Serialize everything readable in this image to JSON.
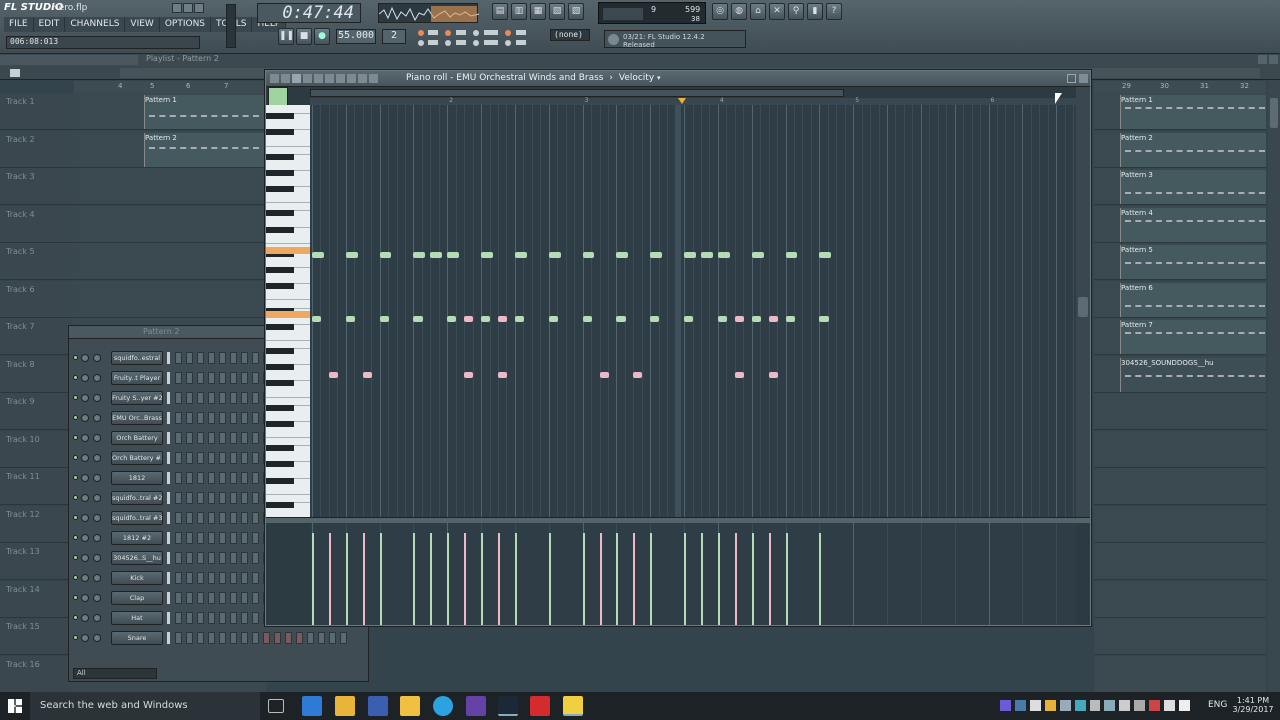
{
  "app": {
    "title": "Hero.flp",
    "logo": "FL STUDIO"
  },
  "menu": [
    "FILE",
    "EDIT",
    "CHANNELS",
    "VIEW",
    "OPTIONS",
    "TOOLS",
    "HELP"
  ],
  "position_readout": "006:08:013",
  "song_time": "0:47:44",
  "tempo": "55.000",
  "pattern_number": "2",
  "pattern_select": "(none)",
  "hint_bar": {
    "line1": "03/21: FL Studio 12.4.2",
    "line2": "Released"
  },
  "cpu": {
    "poly": "9",
    "mem": "599",
    "cpu_val": "38"
  },
  "playlist": {
    "title": "Playlist - Pattern 2",
    "ruler": [
      "4",
      "5",
      "6",
      "7"
    ],
    "right_ruler": [
      "29",
      "30",
      "31",
      "32"
    ]
  },
  "tracks": [
    "Track 1",
    "Track 2",
    "Track 3",
    "Track 4",
    "Track 5",
    "Track 6",
    "Track 7",
    "Track 8",
    "Track 9",
    "Track 10",
    "Track 11",
    "Track 12",
    "Track 13",
    "Track 14",
    "Track 15",
    "Track 16"
  ],
  "left_patterns": [
    "Pattern 1",
    "Pattern 2"
  ],
  "right_patterns": [
    "Pattern 1",
    "Pattern 2",
    "Pattern 3",
    "Pattern 4",
    "Pattern 5",
    "Pattern 6",
    "Pattern 7",
    "304526_SOUNDDOGS__hu"
  ],
  "channel_rack": {
    "title": "Pattern 2",
    "filter": "All",
    "channels": [
      "squidfo..estral",
      "Fruity..t Player",
      "Fruity S..yer #2",
      "EMU Orc..Brass",
      "Orch Battery",
      "Orch Battery #2",
      "1812",
      "squidfo..tral #2",
      "squidfo..tral #3",
      "1812 #2",
      "304526..S__hu",
      "Kick",
      "Clap",
      "Hat",
      "Snare"
    ]
  },
  "piano_roll": {
    "title": "Piano roll - EMU Orchestral Winds and Brass",
    "sep": "›",
    "target": "Velocity",
    "bars": [
      "2",
      "3",
      "4",
      "5",
      "6"
    ]
  },
  "notes": {
    "row1": [
      [
        1.0,
        0.35
      ],
      [
        1.25,
        0.35
      ],
      [
        1.5,
        0.35
      ],
      [
        1.75,
        0.35
      ],
      [
        1.875,
        0.35
      ],
      [
        2.0,
        0.35
      ],
      [
        2.25,
        0.35
      ],
      [
        2.5,
        0.35
      ],
      [
        2.75,
        0.35
      ],
      [
        3.0,
        0.35
      ],
      [
        3.25,
        0.35
      ],
      [
        3.5,
        0.35
      ],
      [
        3.75,
        0.35
      ],
      [
        3.875,
        0.35
      ],
      [
        4.0,
        0.35
      ],
      [
        4.25,
        0.35
      ],
      [
        4.5,
        0.35
      ],
      [
        4.75,
        0.35
      ]
    ],
    "row2": [
      [
        1.0,
        0.27,
        "g"
      ],
      [
        1.25,
        0.27,
        "g"
      ],
      [
        1.5,
        0.27,
        "g"
      ],
      [
        1.75,
        0.27,
        "g"
      ],
      [
        2.0,
        0.27,
        "g"
      ],
      [
        2.125,
        0.27,
        "p"
      ],
      [
        2.25,
        0.27,
        "g"
      ],
      [
        2.375,
        0.27,
        "p"
      ],
      [
        2.5,
        0.27,
        "g"
      ],
      [
        2.75,
        0.27,
        "g"
      ],
      [
        3.0,
        0.27,
        "g"
      ],
      [
        3.25,
        0.27,
        "g"
      ],
      [
        3.5,
        0.27,
        "g"
      ],
      [
        3.75,
        0.27,
        "g"
      ],
      [
        4.0,
        0.27,
        "g"
      ],
      [
        4.125,
        0.27,
        "p"
      ],
      [
        4.25,
        0.27,
        "g"
      ],
      [
        4.375,
        0.27,
        "p"
      ],
      [
        4.5,
        0.27,
        "g"
      ],
      [
        4.75,
        0.27,
        "g"
      ]
    ],
    "row3": [
      [
        1.125,
        0.27
      ],
      [
        1.375,
        0.27
      ],
      [
        2.125,
        0.27
      ],
      [
        2.375,
        0.27
      ],
      [
        3.125,
        0.27
      ],
      [
        3.375,
        0.27
      ],
      [
        4.125,
        0.27
      ],
      [
        4.375,
        0.27
      ]
    ]
  },
  "velocity_level": 0.92,
  "taskbar": {
    "search": "Search the web and Windows",
    "time": "1:41 PM",
    "date": "3/29/2017",
    "lang": "ENG"
  },
  "colors": {
    "note_green": "#b4ddb6",
    "note_pink": "#edb9c4",
    "bg": "#34444d"
  }
}
